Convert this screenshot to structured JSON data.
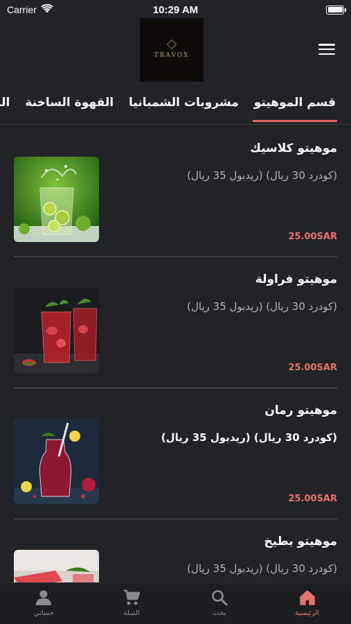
{
  "status_bar": {
    "carrier": "Carrier",
    "time": "10:29 AM"
  },
  "header": {
    "logo_text": "TRAVOX",
    "menu_icon": "hamburger-menu-icon"
  },
  "tabs": [
    {
      "label": "قسم الموهيتو",
      "active": true
    },
    {
      "label": "مشروبات الشمبانيا",
      "active": false
    },
    {
      "label": "القهوة الساخنة",
      "active": false
    },
    {
      "label": "المشروبات",
      "active": false
    }
  ],
  "products": [
    {
      "name": "موهيتو كلاسيك",
      "description": "(كودرد 30 ريال) (ريدبول 35 ريال)",
      "price": "25.00SAR",
      "image": "green-mojito-photo"
    },
    {
      "name": "موهيتو فراولة",
      "description": "(كودرد 30 ريال) (ريدبول 35 ريال)",
      "price": "25.00SAR",
      "image": "strawberry-mojito-photo"
    },
    {
      "name": "موهيتو رمان",
      "description": "(كودرد 30 ريال) (ريدبول 35 ريال)",
      "price": "25.00SAR",
      "image": "pomegranate-mojito-photo"
    },
    {
      "name": "موهيتو بطيخ",
      "description": "(كودرد 30 ريال) (ريدبول 35 ريال)",
      "price": "",
      "image": "watermelon-mojito-photo"
    }
  ],
  "bottom_nav": [
    {
      "label": "حسابي",
      "icon": "person-icon",
      "active": false
    },
    {
      "label": "السلة",
      "icon": "cart-icon",
      "active": false
    },
    {
      "label": "بحث",
      "icon": "search-icon",
      "active": false
    },
    {
      "label": "الرئيسية",
      "icon": "home-icon",
      "active": true
    }
  ],
  "colors": {
    "background": "#222326",
    "accent": "#e85f5c",
    "price": "#e8736a",
    "nav_background": "#1c1d20"
  }
}
